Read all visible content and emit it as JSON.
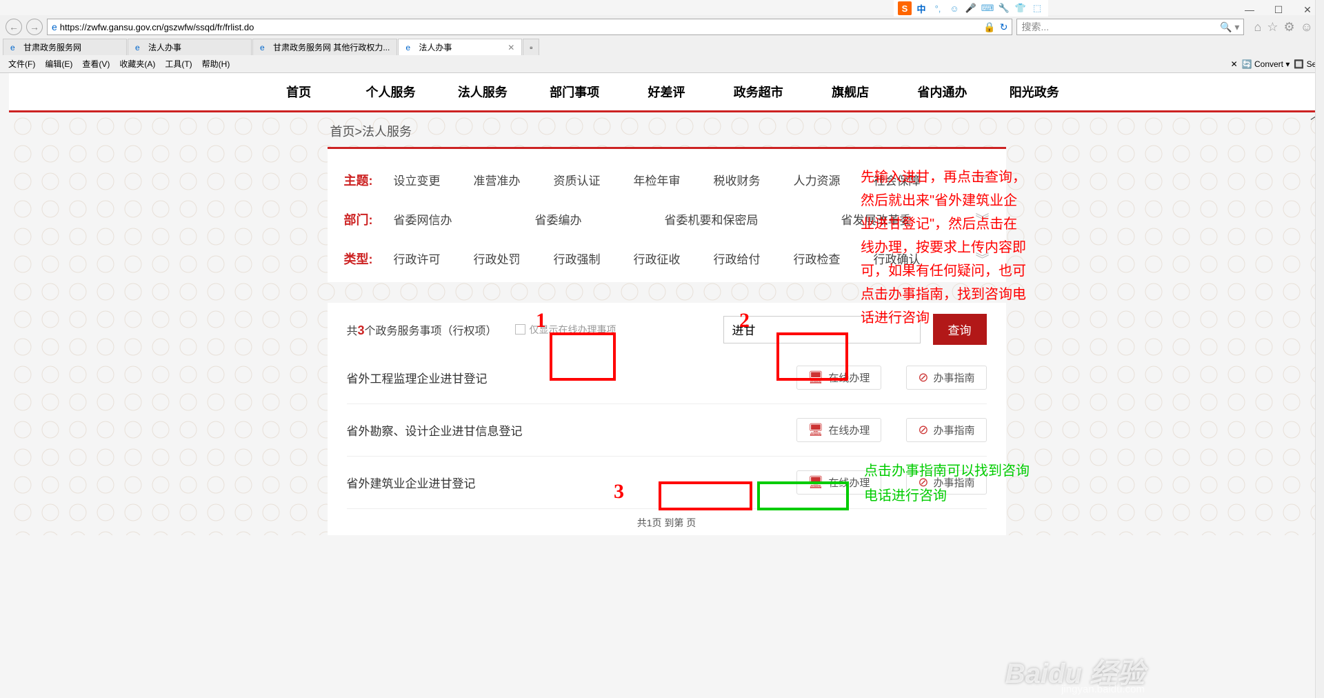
{
  "ime": {
    "letter": "S",
    "zhong": "中",
    "icons": [
      "°,",
      "☺",
      "🎤",
      "⌨",
      "🔧",
      "👕",
      "⬚"
    ]
  },
  "window": {
    "min": "—",
    "max": "☐",
    "close": "✕"
  },
  "browser": {
    "url": "https://zwfw.gansu.gov.cn/gszwfw/ssqd/fr/frlist.do",
    "search_placeholder": "搜索...",
    "tabs": [
      {
        "title": "甘肃政务服务网",
        "active": false
      },
      {
        "title": "法人办事",
        "active": false
      },
      {
        "title": "甘肃政务服务网 其他行政权力...",
        "active": false
      },
      {
        "title": "法人办事",
        "active": true
      }
    ],
    "menu": [
      "文件(F)",
      "编辑(E)",
      "查看(V)",
      "收藏夹(A)",
      "工具(T)",
      "帮助(H)"
    ],
    "menu_right": {
      "close": "✕",
      "convert": "Convert",
      "sel": "Sel"
    }
  },
  "nav": [
    "首页",
    "个人服务",
    "法人服务",
    "部门事项",
    "好差评",
    "政务超市",
    "旗舰店",
    "省内通办",
    "阳光政务"
  ],
  "breadcrumb": "首页>法人服务",
  "filters": {
    "topic": {
      "label": "主题:",
      "opts": [
        "设立变更",
        "准营准办",
        "资质认证",
        "年检年审",
        "税收财务",
        "人力资源",
        "社会保障"
      ]
    },
    "dept": {
      "label": "部门:",
      "opts": [
        "省委网信办",
        "省委编办",
        "省委机要和保密局",
        "省发展改革委"
      ]
    },
    "type": {
      "label": "类型:",
      "opts": [
        "行政许可",
        "行政处罚",
        "行政强制",
        "行政征收",
        "行政给付",
        "行政检查",
        "行政确认"
      ]
    }
  },
  "results": {
    "count_prefix": "共",
    "count_num": "3",
    "count_suffix": "个政务服务事项（行权项）",
    "checkbox_label": "仅显示在线办理事项",
    "search_value": "进甘",
    "search_btn": "查询",
    "items": [
      {
        "title": "省外工程监理企业进甘登记"
      },
      {
        "title": "省外勘察、设计企业进甘信息登记"
      },
      {
        "title": "省外建筑业企业进甘登记"
      }
    ],
    "action1": "在线办理",
    "action2": "办事指南",
    "pagination": "共1页  到第          页"
  },
  "annotations": {
    "note1": "先输入进甘，再点击查询，然后就出来\"省外建筑业企业进甘登记\"，然后点击在线办理，按要求上传内容即可，如果有任何疑问，也可点击办事指南，找到咨询电话进行咨询",
    "note2": "点击办事指南可以找到咨询电话进行咨询",
    "num1": "1",
    "num2": "2",
    "num3": "3"
  },
  "colors": {
    "accent": "#c22",
    "btn": "#b21818"
  }
}
